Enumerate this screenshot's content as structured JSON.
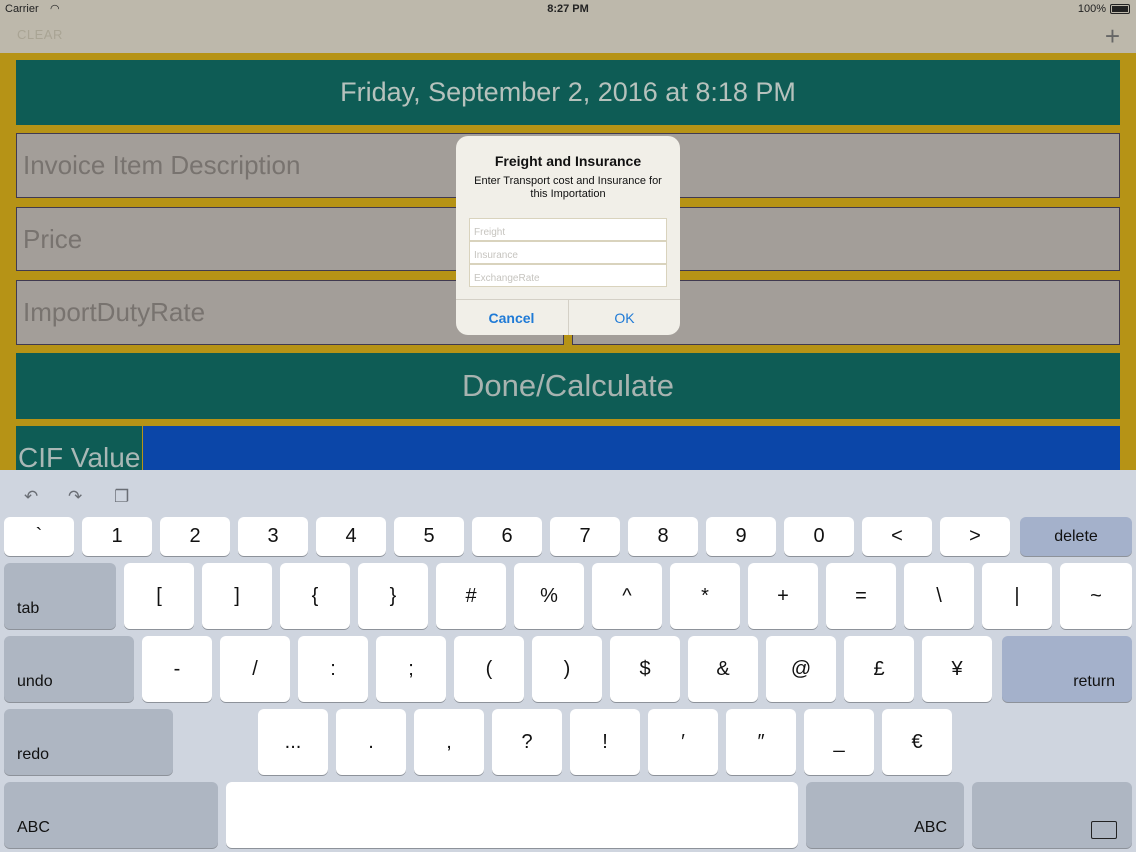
{
  "status": {
    "carrier": "Carrier",
    "time": "8:27 PM",
    "battery": "100%"
  },
  "nav": {
    "clear_label": "CLEAR",
    "add_icon": "+"
  },
  "form": {
    "date": "Friday, September 2, 2016 at 8:18 PM",
    "item_description_placeholder": "Invoice Item Description",
    "price_placeholder": "Price",
    "import_duty_placeholder": "ImportDutyRate",
    "done_label": "Done/Calculate",
    "cif_label": "CIF Value"
  },
  "alert": {
    "title": "Freight and Insurance",
    "message": "Enter Transport cost and Insurance for this Importation",
    "fields": [
      {
        "placeholder": "Freight"
      },
      {
        "placeholder": "Insurance"
      },
      {
        "placeholder": "ExchangeRate"
      }
    ],
    "cancel_label": "Cancel",
    "ok_label": "OK"
  },
  "keyboard": {
    "row1": [
      "`",
      "1",
      "2",
      "3",
      "4",
      "5",
      "6",
      "7",
      "8",
      "9",
      "0",
      "<",
      ">"
    ],
    "delete_label": "delete",
    "tab_label": "tab",
    "row2": [
      "[",
      "]",
      "{",
      "}",
      "#",
      "%",
      "^",
      "*",
      "+",
      "=",
      "\\",
      "|",
      "~"
    ],
    "undo_label": "undo",
    "row3": [
      "-",
      "/",
      ":",
      ";",
      "(",
      ")",
      "$",
      "&",
      "@",
      "£",
      "¥"
    ],
    "return_label": "return",
    "redo_label": "redo",
    "row4": [
      "...",
      ".",
      ",",
      "?",
      "!",
      "′",
      "″",
      "_",
      "€"
    ],
    "abc_left_label": "ABC",
    "abc_right_label": "ABC"
  }
}
